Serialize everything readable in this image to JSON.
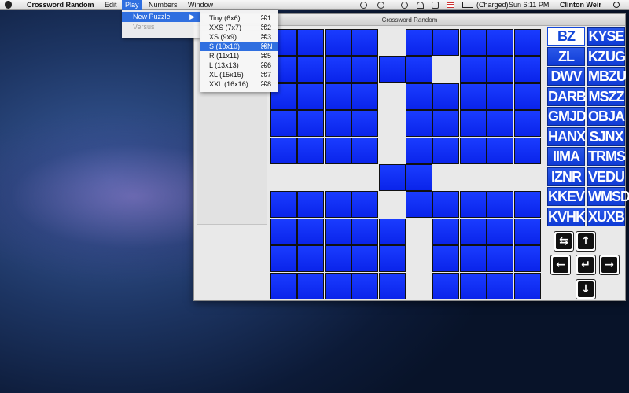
{
  "menubar": {
    "app_name": "Crossword Random",
    "menus": [
      "Edit",
      "Play",
      "Numbers",
      "Window"
    ],
    "status": {
      "battery": "(Charged)",
      "clock": "Sun 6:11 PM",
      "user": "Clinton Weir"
    }
  },
  "play_menu": {
    "new_puzzle": "New Puzzle",
    "submenu_arrow": "▶",
    "versus": "Versus"
  },
  "puzzle_sizes": [
    {
      "label": "Tiny (6x6)",
      "shortcut": "⌘1"
    },
    {
      "label": "XXS (7x7)",
      "shortcut": "⌘2"
    },
    {
      "label": "XS (9x9)",
      "shortcut": "⌘3"
    },
    {
      "label": "S (10x10)",
      "shortcut": "⌘N",
      "selected": true
    },
    {
      "label": "R (11x11)",
      "shortcut": "⌘5"
    },
    {
      "label": "L (13x13)",
      "shortcut": "⌘6"
    },
    {
      "label": "XL (15x15)",
      "shortcut": "⌘7"
    },
    {
      "label": "XXL (16x16)",
      "shortcut": "⌘8"
    }
  ],
  "window": {
    "title": "Crossword Random"
  },
  "grid": {
    "size": 10,
    "rows": [
      "1111011111",
      "1111110111",
      "1111011111",
      "1111011111",
      "1111011111",
      "0000110000",
      "1111011111",
      "1111101111",
      "1111101111",
      "1111101111"
    ]
  },
  "words": [
    "BZ",
    "KYSE",
    "ZL",
    "KZUG",
    "DWV",
    "MBZU",
    "DARB",
    "MSZZ",
    "GMJD",
    "OBJA",
    "HANX",
    "SJNX",
    "IIMA",
    "TRMS",
    "IZNR",
    "VEDU",
    "KKEV",
    "WMSD",
    "KVHK",
    "XUXB"
  ],
  "selected_word": "BZ",
  "controls": {
    "swap": "⇆",
    "up": "↑",
    "left": "←",
    "enter": "↵",
    "right": "→",
    "down": "↓"
  }
}
